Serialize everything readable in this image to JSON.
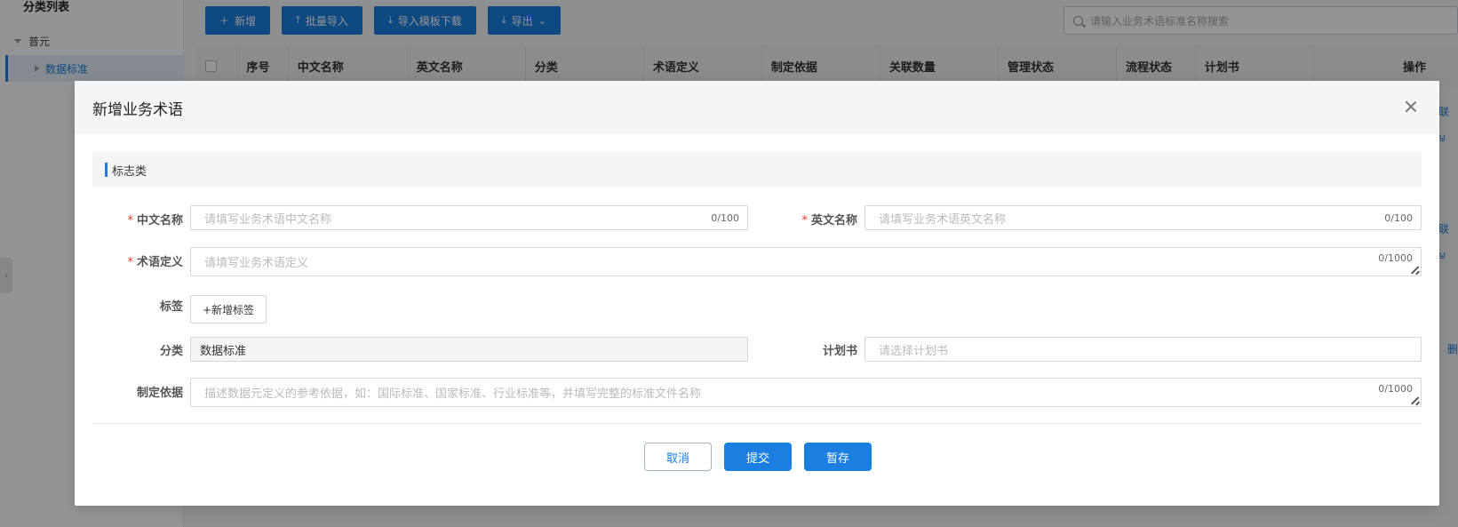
{
  "sidebar": {
    "title": "分类列表",
    "tree_root": "普元",
    "tree_child": "数据标准"
  },
  "toolbar": {
    "add_label": "新增",
    "batch_import_label": "批量导入",
    "template_download_label": "导入模板下载",
    "export_label": "导出"
  },
  "search": {
    "placeholder": "请输入业务术语标准名称搜索"
  },
  "table": {
    "headers": [
      "序号",
      "中文名称",
      "英文名称",
      "分类",
      "术语定义",
      "制定依据",
      "关联数量",
      "管理状态",
      "流程状态",
      "计划书",
      "操作"
    ]
  },
  "background_links": [
    "联",
    "联",
    "删"
  ],
  "modal": {
    "title": "新增业务术语",
    "section_title": "标志类",
    "fields": {
      "cn_name": {
        "label": "中文名称",
        "placeholder": "请填写业务术语中文名称",
        "counter": "0/100"
      },
      "en_name": {
        "label": "英文名称",
        "placeholder": "请填写业务术语英文名称",
        "counter": "0/100"
      },
      "definition": {
        "label": "术语定义",
        "placeholder": "请填写业务术语定义",
        "counter": "0/1000"
      },
      "tags": {
        "label": "标签",
        "add_label": "+新增标签"
      },
      "category": {
        "label": "分类",
        "value": "数据标准"
      },
      "plan": {
        "label": "计划书",
        "placeholder": "请选择计划书"
      },
      "basis": {
        "label": "制定依据",
        "placeholder": "描述数据元定义的参考依据，如：国际标准、国家标准、行业标准等，并填写完整的标准文件名称",
        "counter": "0/1000"
      }
    },
    "buttons": {
      "cancel": "取消",
      "submit": "提交",
      "draft": "暂存"
    }
  }
}
